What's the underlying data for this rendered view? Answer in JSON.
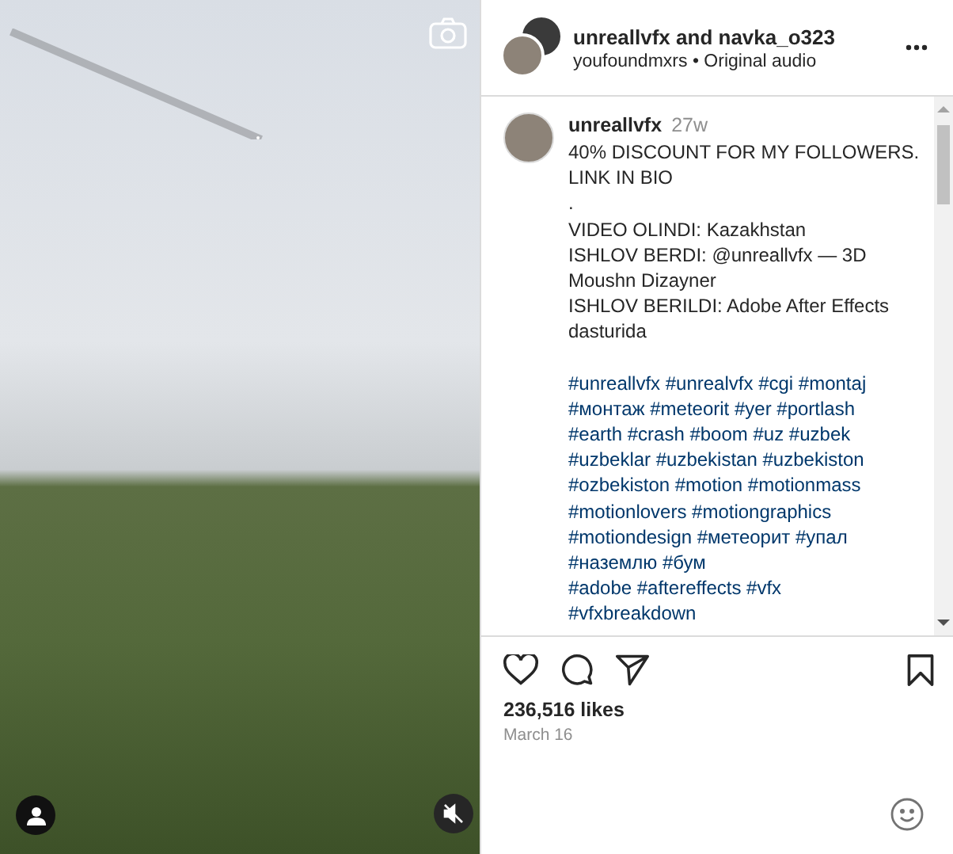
{
  "header": {
    "authors": "unreallvfx and navka_o323",
    "audio_author": "youfoundmxrs",
    "separator": "•",
    "audio_title": "Original audio"
  },
  "caption": {
    "username": "unreallvfx",
    "age": "27w",
    "paragraphs": [
      [
        "40% DISCOUNT FOR MY FOLLOWERS.",
        "LINK IN BIO",
        ".",
        "VIDEO OLINDI: Kazakhstan",
        "ISHLOV BERDI: @unreallvfx — 3D",
        "Moushn Dizayner",
        "ISHLOV BERILDI: Adobe After Effects",
        "dasturida"
      ],
      [
        "#unreallvfx #unrealvfx #cgi #montaj",
        "#монтаж #meteorit #yer #portlash",
        "#earth #crash #boom #uz #uzbek",
        "#uzbeklar #uzbekistan #uzbekiston",
        "#ozbekiston #motion #motionmass",
        "#motionlovers #motiongraphics",
        "#motiondesign #метеорит #упал",
        "#наземлю #бум",
        "#adobe #aftereffects #vfx",
        "#vfxbreakdown"
      ]
    ]
  },
  "likes": "236,516 likes",
  "date": "March 16",
  "liked": false,
  "saved": false,
  "muted": true
}
